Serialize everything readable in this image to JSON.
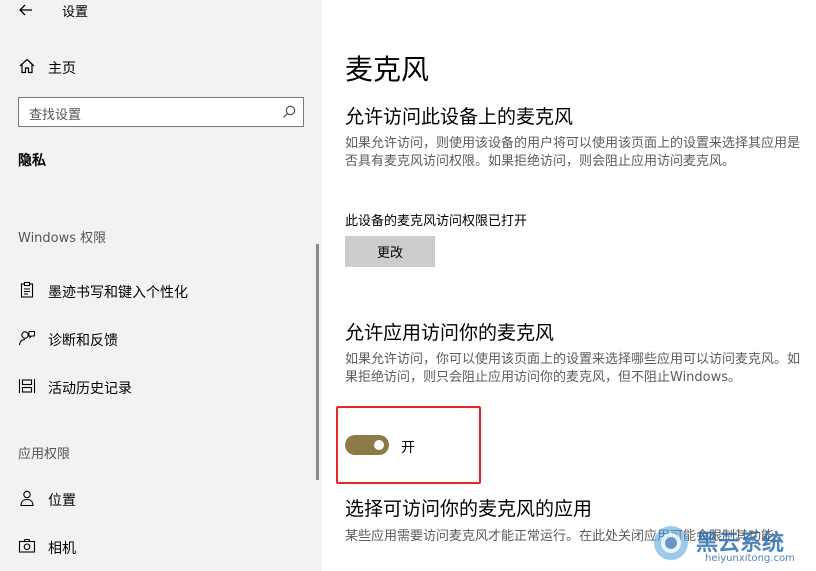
{
  "app": {
    "title": "设置"
  },
  "sidebar": {
    "home_label": "主页",
    "search_placeholder": "查找设置",
    "section_title": "隐私",
    "windows_group": "Windows 权限",
    "windows_items": [
      {
        "label": "墨迹书写和键入个性化",
        "icon": "pen-clipboard-icon"
      },
      {
        "label": "诊断和反馈",
        "icon": "person-feedback-icon"
      },
      {
        "label": "活动历史记录",
        "icon": "activity-history-icon"
      }
    ],
    "app_group": "应用权限",
    "app_items": [
      {
        "label": "位置",
        "icon": "person-location-icon"
      },
      {
        "label": "相机",
        "icon": "camera-icon"
      }
    ]
  },
  "main": {
    "title": "麦克风",
    "device_section": {
      "heading": "允许访问此设备上的麦克风",
      "description": "如果允许访问，则使用该设备的用户将可以使用该页面上的设置来选择其应用是否具有麦克风访问权限。如果拒绝访问，则会阻止应用访问麦克风。",
      "status": "此设备的麦克风访问权限已打开",
      "button": "更改"
    },
    "app_section": {
      "heading": "允许应用访问你的麦克风",
      "description": "如果允许访问，你可以使用该页面上的设置来选择哪些应用可以访问麦克风。如果拒绝访问，则只会阻止应用访问你的麦克风，但不阻止Windows。",
      "toggle_state": "开",
      "toggle_on": true
    },
    "choose_section": {
      "heading": "选择可访问你的麦克风的应用",
      "description": "某些应用需要访问麦克风才能正常运行。在此处关闭应用可能会限制其功能。"
    }
  },
  "watermark": {
    "brand": "黑云系统",
    "url": "heiyunxitong.com"
  },
  "colors": {
    "toggle_on": "#8c7b46",
    "highlight": "#e8262a",
    "sidebar_bg": "#f2f2f2"
  }
}
